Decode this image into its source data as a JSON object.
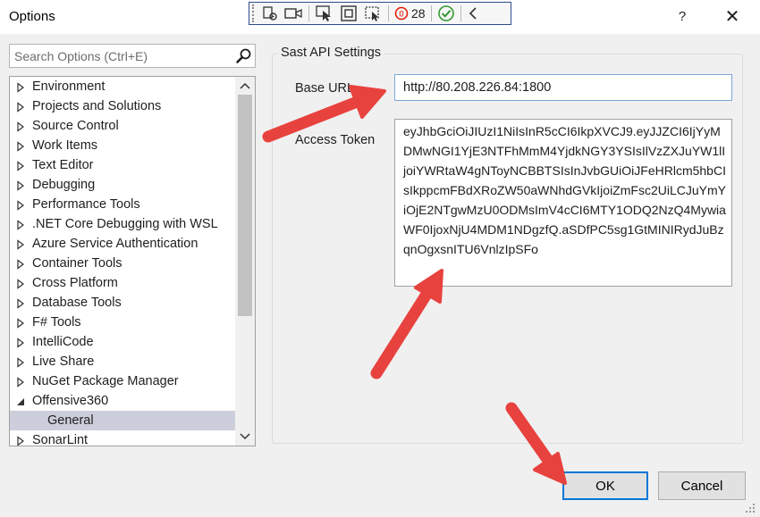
{
  "window": {
    "title": "Options",
    "help_glyph": "?",
    "close_glyph": "✕"
  },
  "toolbar": {
    "error_count": "28",
    "error_color": "#e51400",
    "ok_color": "#339933"
  },
  "search": {
    "placeholder": "Search Options (Ctrl+E)",
    "value": ""
  },
  "tree": {
    "items": [
      {
        "label": "Environment",
        "state": "collapsed"
      },
      {
        "label": "Projects and Solutions",
        "state": "collapsed"
      },
      {
        "label": "Source Control",
        "state": "collapsed"
      },
      {
        "label": "Work Items",
        "state": "collapsed"
      },
      {
        "label": "Text Editor",
        "state": "collapsed"
      },
      {
        "label": "Debugging",
        "state": "collapsed"
      },
      {
        "label": "Performance Tools",
        "state": "collapsed"
      },
      {
        "label": ".NET Core Debugging with WSL",
        "state": "collapsed"
      },
      {
        "label": "Azure Service Authentication",
        "state": "collapsed"
      },
      {
        "label": "Container Tools",
        "state": "collapsed"
      },
      {
        "label": "Cross Platform",
        "state": "collapsed"
      },
      {
        "label": "Database Tools",
        "state": "collapsed"
      },
      {
        "label": "F# Tools",
        "state": "collapsed"
      },
      {
        "label": "IntelliCode",
        "state": "collapsed"
      },
      {
        "label": "Live Share",
        "state": "collapsed"
      },
      {
        "label": "NuGet Package Manager",
        "state": "collapsed"
      },
      {
        "label": "Offensive360",
        "state": "expanded"
      },
      {
        "label": "General",
        "state": "child",
        "selected": true
      },
      {
        "label": "SonarLint",
        "state": "collapsed"
      }
    ]
  },
  "settings": {
    "group_label": "Sast API Settings",
    "base_url_label": "Base URL",
    "base_url_value": "http://80.208.226.84:1800",
    "access_token_label": "Access Token",
    "access_token_value": "eyJhbGciOiJIUzI1NiIsInR5cCI6IkpXVCJ9.eyJJZCI6IjYyMDMwNGI1YjE3NTFhMmM4YjdkNGY3YSIsIlVzZXJuYW1lIjoiYWRtaW4gNToyNCBBTSIsInJvbGUiOiJFeHRlcm5hbCIsIkppcmFBdXRoZW50aWNhdGVkIjoiZmFsc2UiLCJuYmYiOjE2NTgwMzU0ODMsImV4cCI6MTY1ODQ2NzQ4MywiaWF0IjoxNjU4MDM1NDgzfQ.aSDfPC5sg1GtMINIRydJuBzqnOgxsnITU6VnlzIpSFo"
  },
  "buttons": {
    "ok_label": "OK",
    "cancel_label": "Cancel"
  },
  "annotation_color": "#e8423f"
}
